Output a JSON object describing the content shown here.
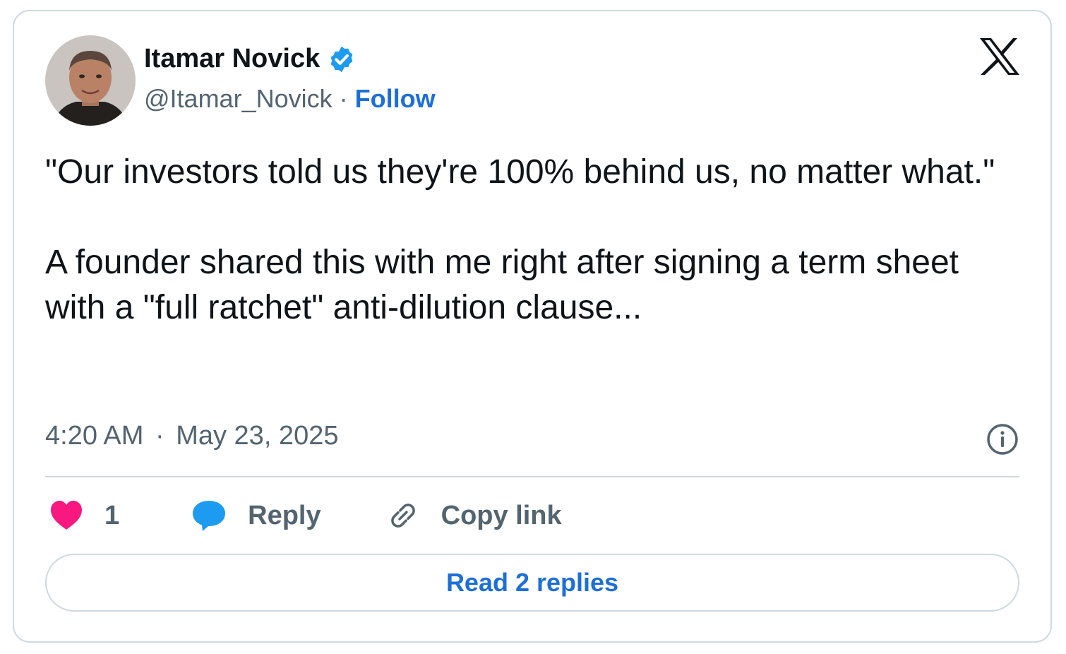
{
  "author": {
    "name": "Itamar Novick",
    "handle": "@Itamar_Novick",
    "separator": "·",
    "follow_label": "Follow",
    "verified": true
  },
  "tweet": {
    "paragraphs": [
      "\"Our investors told us they're 100% behind us, no matter what.\"",
      "A founder shared this with me right after signing a term sheet with a \"full ratchet\" anti-dilution clause..."
    ],
    "time": "4:20 AM",
    "separator": "·",
    "date": "May 23, 2025"
  },
  "actions": {
    "like_count": "1",
    "reply_label": "Reply",
    "copy_link_label": "Copy link"
  },
  "read_replies_label": "Read 2 replies",
  "icons": {
    "platform": "x-logo-icon",
    "verified": "verified-badge-icon",
    "info": "info-icon",
    "like": "heart-icon",
    "reply": "speech-bubble-icon",
    "copy": "link-icon"
  },
  "colors": {
    "accent": "#1d6fd8",
    "verified": "#1d9bf0",
    "like": "#f91880",
    "reply": "#1d9bf0",
    "muted_text": "#536471",
    "border": "#cfd9de"
  }
}
